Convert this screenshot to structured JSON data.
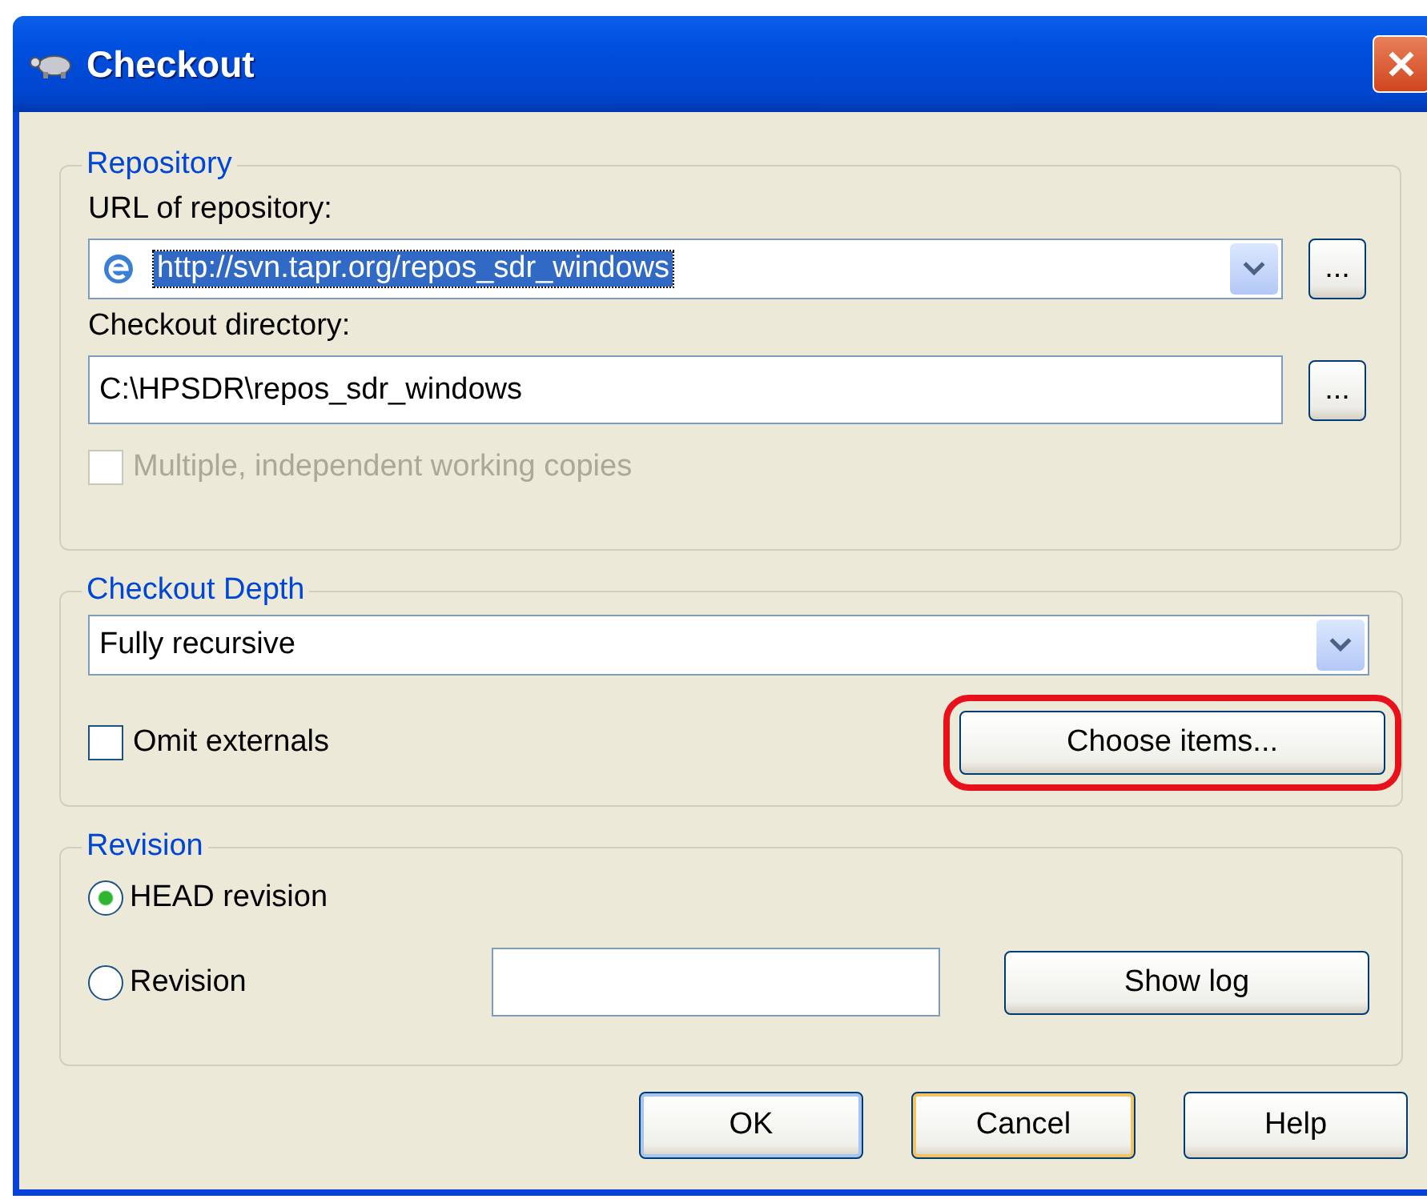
{
  "window": {
    "title": "Checkout"
  },
  "repository": {
    "legend": "Repository",
    "url_label": "URL of repository:",
    "url": {
      "value": "http://svn.tapr.org/repos_sdr_windows",
      "selected": true
    },
    "url_browse": "...",
    "dir_label": "Checkout directory:",
    "dir": {
      "value": "C:\\HPSDR\\repos_sdr_windows"
    },
    "dir_browse": "...",
    "multiple": {
      "label": "Multiple, independent working copies",
      "checked": false,
      "disabled": true
    }
  },
  "depth": {
    "legend": "Checkout Depth",
    "dropdown": "Fully recursive",
    "omit": {
      "label": "Omit externals",
      "checked": false,
      "disabled": false
    },
    "choose": {
      "label": "Choose items...",
      "highlighted": true
    }
  },
  "revision": {
    "legend": "Revision",
    "radios": [
      {
        "label": "HEAD revision",
        "selected": true
      },
      {
        "label": "Revision",
        "selected": false
      }
    ],
    "show_log": "Show log"
  },
  "buttons": [
    {
      "label": "OK",
      "default": true,
      "hover": false
    },
    {
      "label": "Cancel",
      "default": false,
      "hover": true
    },
    {
      "label": "Help",
      "default": false,
      "hover": false
    }
  ]
}
